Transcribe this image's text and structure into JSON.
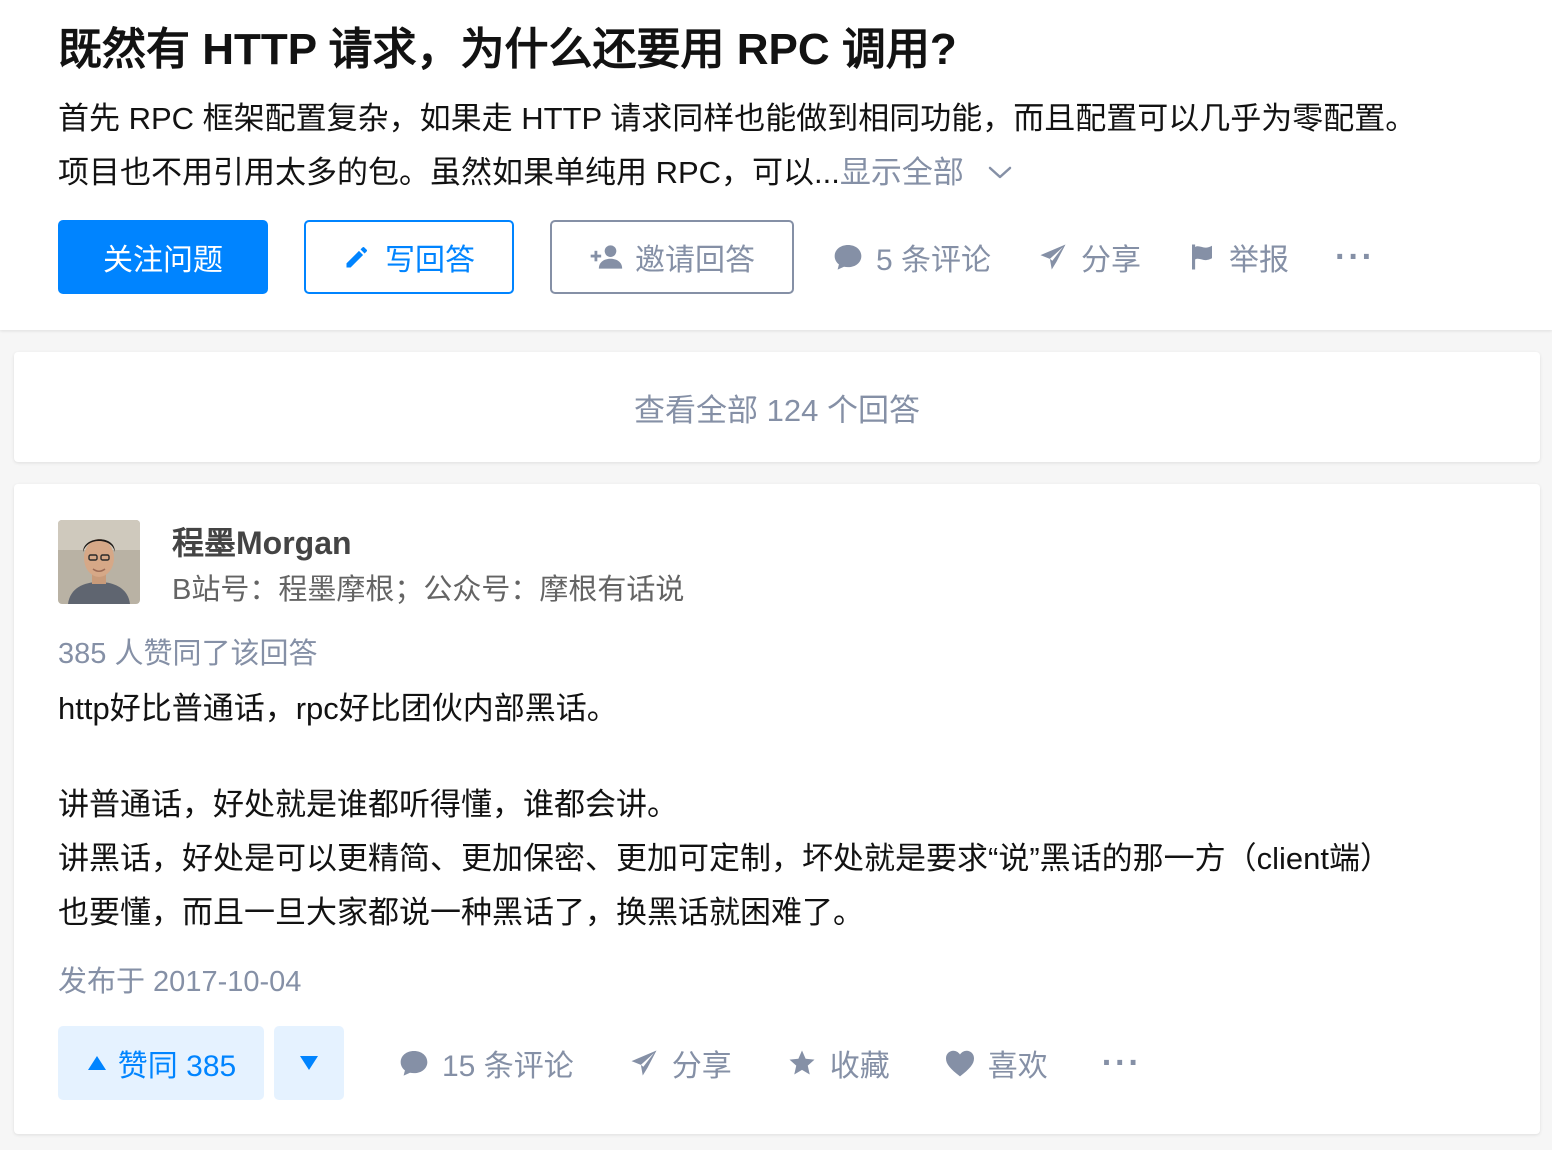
{
  "question": {
    "title": "既然有 HTTP 请求，为什么还要用 RPC 调用?",
    "detail_line1": "首先 RPC 框架配置复杂，如果走 HTTP 请求同样也能做到相同功能，而且配置可以几乎为零配置。",
    "detail_line2": "项目也不用引用太多的包。虽然如果单纯用 RPC，可以...",
    "show_all": "显示全部",
    "actions": {
      "follow": "关注问题",
      "write": "写回答",
      "invite": "邀请回答",
      "comments": "5 条评论",
      "share": "分享",
      "report": "举报",
      "more": "···"
    }
  },
  "view_all": "查看全部 124 个回答",
  "answer": {
    "author": {
      "name": "程墨Morgan",
      "headline": "B站号：程墨摩根；公众号：摩根有话说"
    },
    "vote_summary": "385 人赞同了该回答",
    "paragraphs": [
      "http好比普通话，rpc好比团伙内部黑话。",
      "讲普通话，好处就是谁都听得懂，谁都会讲。",
      "讲黑话，好处是可以更精简、更加保密、更加可定制，坏处就是要求“说”黑话的那一方（client端）",
      "也要懂，而且一旦大家都说一种黑话了，换黑话就困难了。"
    ],
    "published": "发布于 2017-10-04",
    "actions": {
      "upvote": "赞同 385",
      "comments": "15 条评论",
      "share": "分享",
      "collect": "收藏",
      "like": "喜欢",
      "more": "···"
    }
  },
  "colors": {
    "accent": "#0084ff",
    "muted": "#8590a6",
    "text": "#121212",
    "background": "#f6f6f6"
  },
  "icons": [
    "pencil-icon",
    "add-person-icon",
    "comment-icon",
    "paper-plane-icon",
    "flag-icon",
    "chevron-down-icon",
    "triangle-up-icon",
    "triangle-down-icon",
    "star-icon",
    "heart-icon"
  ]
}
